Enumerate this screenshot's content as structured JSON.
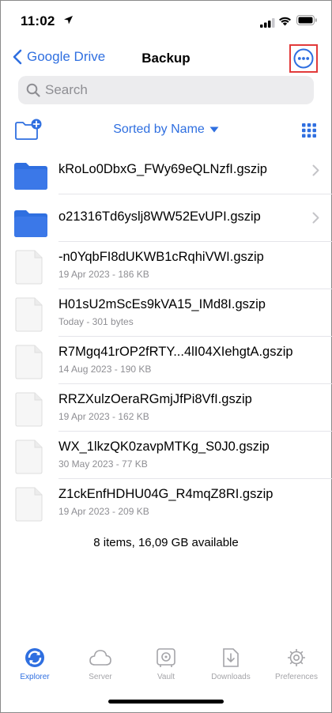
{
  "status_bar": {
    "time": "11:02",
    "icons": [
      "location-arrow-icon",
      "cellular-signal-icon",
      "wifi-icon",
      "battery-icon"
    ]
  },
  "nav": {
    "back_label": "Google Drive",
    "title": "Backup",
    "more_icon": "ellipsis-circle-icon",
    "highlight_color": "#e23a3a"
  },
  "search": {
    "placeholder": "Search"
  },
  "toolbar": {
    "sort_label": "Sorted by Name",
    "new_folder_icon": "new-folder-icon",
    "view_icon": "grid-view-icon"
  },
  "files": [
    {
      "type": "folder",
      "name": "kRoLo0DbxG_FWy69eQLNzfI.gszip"
    },
    {
      "type": "folder",
      "name": "o21316Td6yslj8WW52EvUPI.gszip"
    },
    {
      "type": "file",
      "name": "-n0YqbFI8dUKWB1cRqhiVWI.gszip",
      "meta": "19 Apr 2023 - 186 KB"
    },
    {
      "type": "file",
      "name": "H01sU2mScEs9kVA15_IMd8I.gszip",
      "meta": "Today - 301 bytes"
    },
    {
      "type": "file",
      "name": "R7Mgq41rOP2fRTY...4lI04XIehgtA.gszip",
      "meta": "14 Aug 2023 - 190 KB"
    },
    {
      "type": "file",
      "name": "RRZXulzOeraRGmjJfPi8VfI.gszip",
      "meta": "19 Apr 2023 - 162 KB"
    },
    {
      "type": "file",
      "name": "WX_1lkzQK0zavpMTKg_S0J0.gszip",
      "meta": "30 May 2023 - 77 KB"
    },
    {
      "type": "file",
      "name": "Z1ckEnfHDHU04G_R4mqZ8RI.gszip",
      "meta": "19 Apr 2023 - 209 KB"
    }
  ],
  "summary": "8 items, 16,09 GB available",
  "tabs": [
    {
      "label": "Explorer",
      "icon": "explorer-icon",
      "active": true
    },
    {
      "label": "Server",
      "icon": "cloud-icon",
      "active": false
    },
    {
      "label": "Vault",
      "icon": "vault-icon",
      "active": false
    },
    {
      "label": "Downloads",
      "icon": "downloads-icon",
      "active": false
    },
    {
      "label": "Preferences",
      "icon": "gear-icon",
      "active": false
    }
  ],
  "colors": {
    "accent": "#2f6fe0",
    "folder": "#2f6fe0",
    "inactive_tab": "#a4a4a8"
  }
}
